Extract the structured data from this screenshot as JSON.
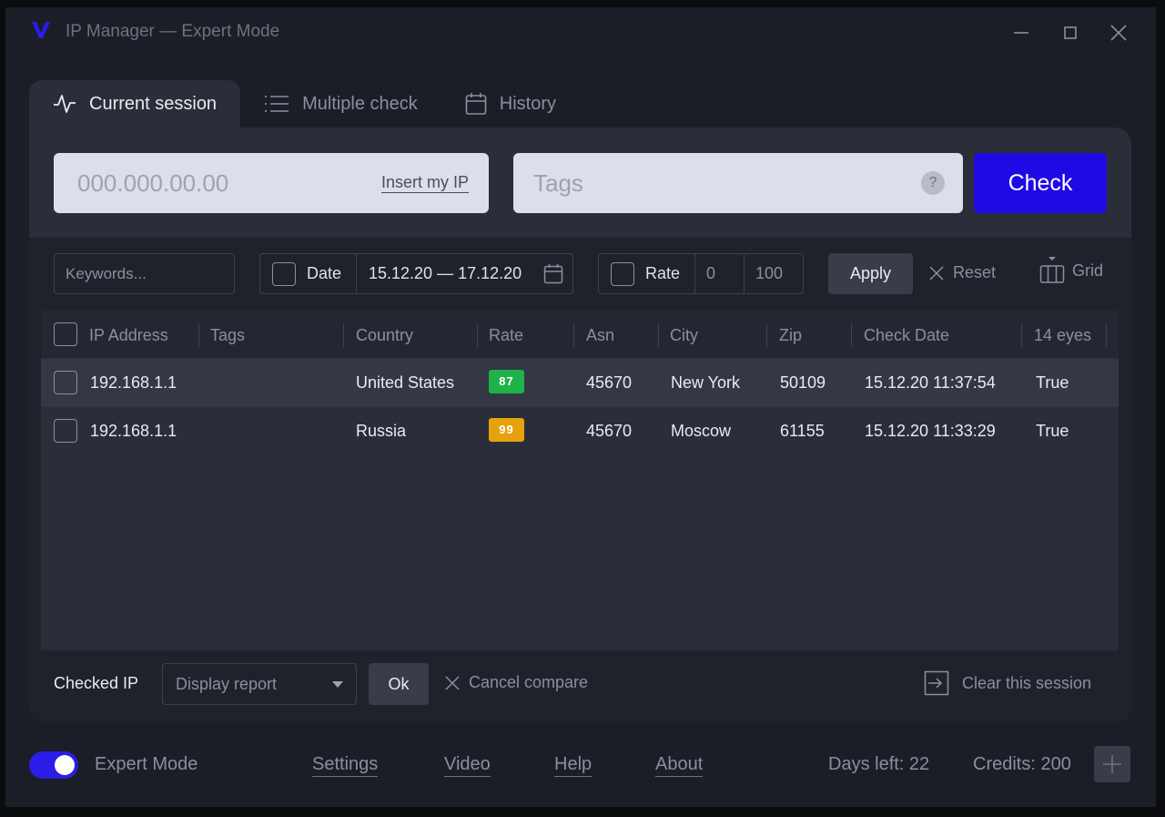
{
  "app": {
    "title": "IP Manager — Expert Mode"
  },
  "tabs": [
    {
      "label": "Current session",
      "icon": "activity-icon",
      "active": true
    },
    {
      "label": "Multiple check",
      "icon": "list-icon",
      "active": false
    },
    {
      "label": "History",
      "icon": "calendar-icon",
      "active": false
    }
  ],
  "ip_input": {
    "placeholder": "000.000.00.00",
    "value": "",
    "insert_label": "Insert my IP"
  },
  "tags_input": {
    "placeholder": "Tags",
    "value": "",
    "help": "?"
  },
  "check_button": "Check",
  "filters": {
    "keywords_placeholder": "Keywords...",
    "date_label": "Date",
    "date_range": "15.12.20 — 17.12.20",
    "rate_label": "Rate",
    "rate_min": "0",
    "rate_max": "100",
    "apply": "Apply",
    "reset": "Reset",
    "grid": "Grid"
  },
  "table": {
    "columns": [
      "IP Address",
      "Tags",
      "Country",
      "Rate",
      "Asn",
      "City",
      "Zip",
      "Check Date",
      "14 eyes"
    ],
    "rows": [
      {
        "ip": "192.168.1.1",
        "tags": "",
        "country": "United States",
        "rate": "87",
        "rate_color": "#1fb14a",
        "asn": "45670",
        "city": "New York",
        "zip": "50109",
        "date": "15.12.20 11:37:54",
        "eyes": "True"
      },
      {
        "ip": "192.168.1.1",
        "tags": "",
        "country": "Russia",
        "rate": "99",
        "rate_color": "#e5a20c",
        "asn": "45670",
        "city": "Moscow",
        "zip": "61155",
        "date": "15.12.20 11:33:29",
        "eyes": "True"
      }
    ]
  },
  "bottom_bar": {
    "checked_label": "Checked IP",
    "report_select": "Display report",
    "ok": "Ok",
    "cancel_compare": "Cancel compare",
    "clear_session": "Clear this session"
  },
  "footer": {
    "expert_mode_label": "Expert Mode",
    "expert_mode_on": true,
    "links": [
      "Settings",
      "Video",
      "Help",
      "About"
    ],
    "days_left": "Days left: 22",
    "credits": "Credits: 200"
  },
  "colors": {
    "accent": "#1f0ae6",
    "background": "#1b1e26",
    "panel": "#2a2e39"
  }
}
